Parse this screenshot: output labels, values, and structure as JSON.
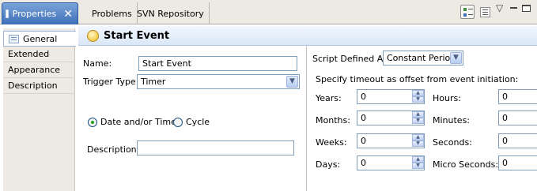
{
  "tabs": [
    {
      "label": "Properties",
      "active": true
    },
    {
      "label": "Problems",
      "active": false
    },
    {
      "label": "SVN Repository",
      "active": false
    }
  ],
  "toolbar_icons": [
    "categories-icon",
    "advanced-icon",
    "view-menu-icon",
    "minimize-icon",
    "maximize-icon"
  ],
  "nav": [
    {
      "label": "General",
      "selected": true
    },
    {
      "label": "Extended",
      "selected": false
    },
    {
      "label": "Appearance",
      "selected": false
    },
    {
      "label": "Description",
      "selected": false
    }
  ],
  "header": {
    "title": "Start Event",
    "icon": "start-event-icon"
  },
  "form": {
    "name_label": "Name:",
    "name_value": "Start Event",
    "trigger_label": "Trigger Type:",
    "trigger_value": "Timer",
    "radio_date_label": "Date and/or Time",
    "radio_cycle_label": "Cycle",
    "radio_selected": "Date and/or Time",
    "description_label": "Description:",
    "description_value": ""
  },
  "timer": {
    "script_label": "Script Defined As:",
    "script_value": "Constant Period",
    "instructions": "Specify timeout as offset from event initiation:",
    "left": [
      {
        "label": "Years:",
        "value": "0"
      },
      {
        "label": "Months:",
        "value": "0"
      },
      {
        "label": "Weeks:",
        "value": "0"
      },
      {
        "label": "Days:",
        "value": "0"
      }
    ],
    "right": [
      {
        "label": "Hours:",
        "value": "0"
      },
      {
        "label": "Minutes:",
        "value": "0"
      },
      {
        "label": "Seconds:",
        "value": "0"
      },
      {
        "label": "Micro Seconds:",
        "value": "0"
      }
    ]
  },
  "colors": {
    "tab_active": "#3f6fb8",
    "header_bg": "#dbe7f7",
    "panel_bg": "#eceae2",
    "radio_selected": "#21a121",
    "header_icon": "#f5cc4a"
  }
}
